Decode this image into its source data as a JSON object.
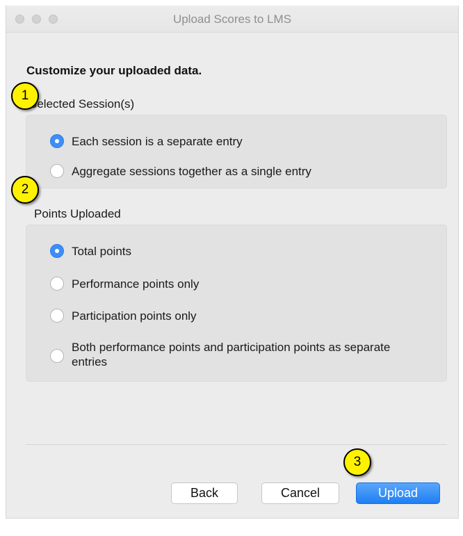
{
  "window": {
    "title": "Upload Scores to LMS"
  },
  "heading": "Customize your uploaded data.",
  "sessions": {
    "label": "Selected Session(s)",
    "options": [
      {
        "label": "Each session is a separate entry",
        "checked": true
      },
      {
        "label": "Aggregate sessions together as a single entry",
        "checked": false
      }
    ]
  },
  "points": {
    "label": "Points Uploaded",
    "options": [
      {
        "label": "Total points",
        "checked": true
      },
      {
        "label": "Performance points only",
        "checked": false
      },
      {
        "label": "Participation points only",
        "checked": false
      },
      {
        "label": "Both performance points and participation points as separate entries",
        "checked": false
      }
    ]
  },
  "buttons": {
    "back": "Back",
    "cancel": "Cancel",
    "upload": "Upload"
  },
  "callouts": [
    "1",
    "2",
    "3"
  ],
  "colors": {
    "accent": "#3d8ef6",
    "callout": "#fff200"
  }
}
